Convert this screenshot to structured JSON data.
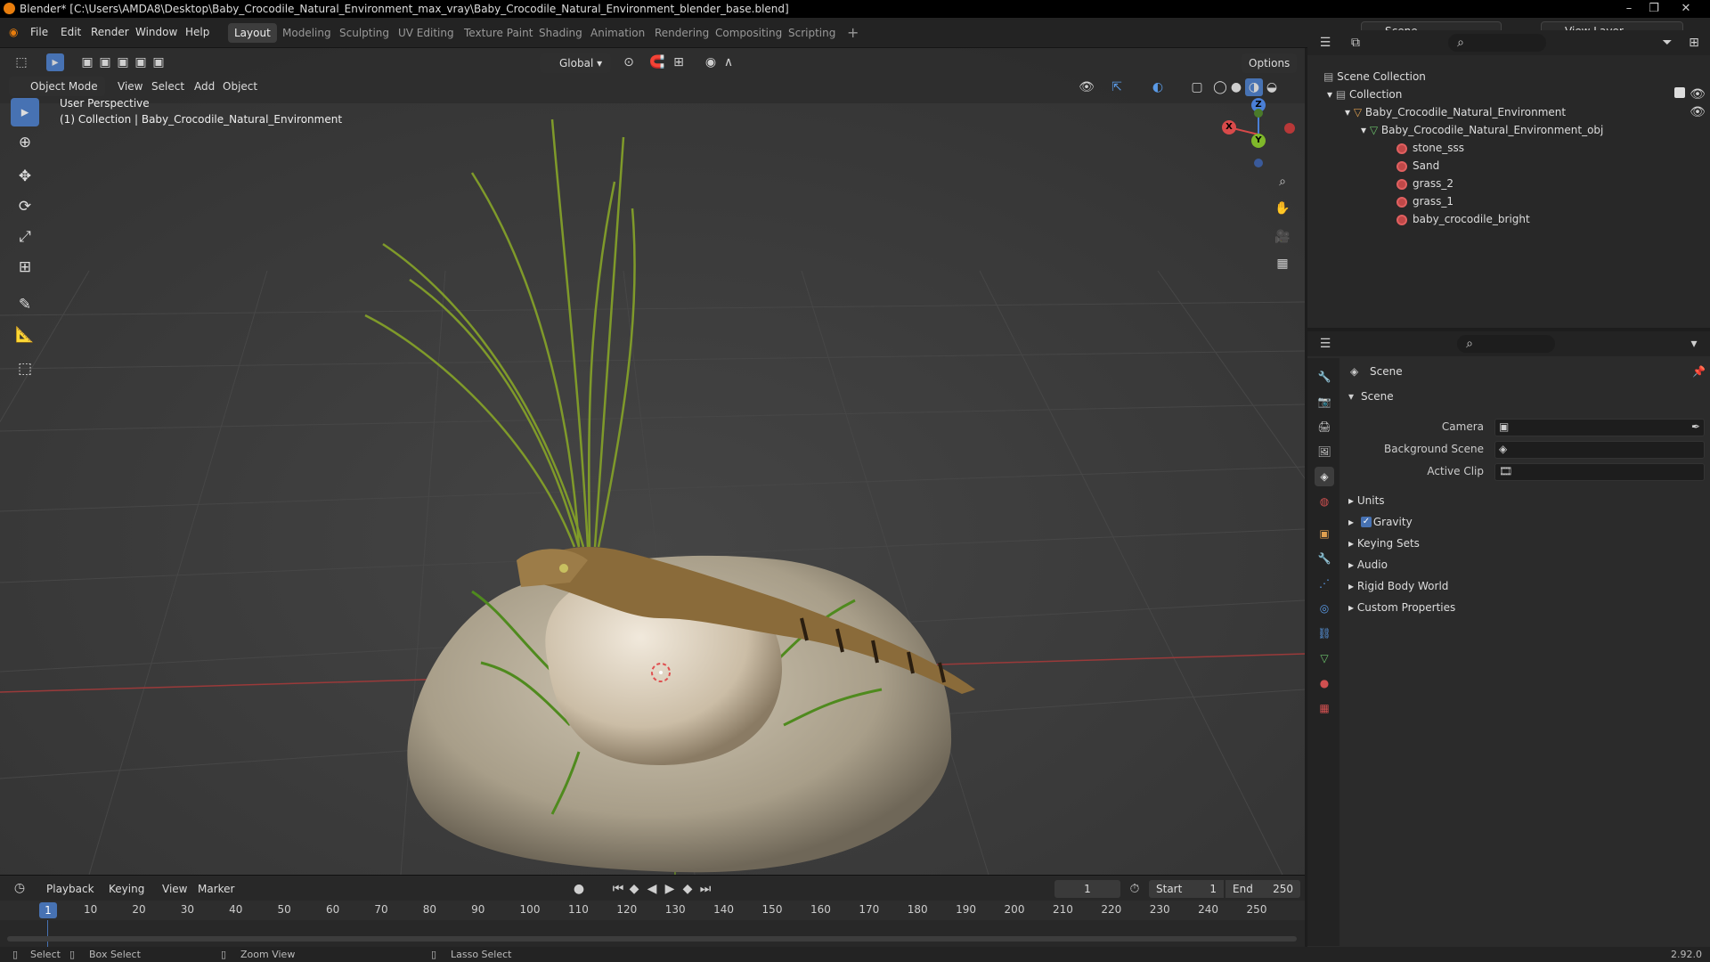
{
  "window": {
    "title": "Blender* [C:\\Users\\AMDA8\\Desktop\\Baby_Crocodile_Natural_Environment_max_vray\\Baby_Crocodile_Natural_Environment_blender_base.blend]"
  },
  "menu": [
    "File",
    "Edit",
    "Render",
    "Window",
    "Help"
  ],
  "workspaces": [
    "Layout",
    "Modeling",
    "Sculpting",
    "UV Editing",
    "Texture Paint",
    "Shading",
    "Animation",
    "Rendering",
    "Compositing",
    "Scripting"
  ],
  "active_workspace": "Layout",
  "scene_field": "Scene",
  "view_layer_field": "View Layer",
  "header": {
    "transform_orientation": "Global",
    "options": "Options",
    "mode": "Object Mode",
    "view_menu": [
      "View",
      "Select",
      "Add",
      "Object"
    ]
  },
  "viewport": {
    "perspective": "User Perspective",
    "collection_info": "(1) Collection | Baby_Crocodile_Natural_Environment",
    "gizmo": {
      "x": "X",
      "y": "Y",
      "z": "Z"
    }
  },
  "outliner": {
    "root": "Scene Collection",
    "collection": "Collection",
    "object": "Baby_Crocodile_Natural_Environment",
    "mesh": "Baby_Crocodile_Natural_Environment_obj",
    "materials": [
      "stone_sss",
      "Sand",
      "grass_2",
      "grass_1",
      "baby_crocodile_bright"
    ]
  },
  "properties": {
    "context": "Scene",
    "panel": "Scene",
    "camera_label": "Camera",
    "background_scene_label": "Background Scene",
    "active_clip_label": "Active Clip",
    "subpanels": [
      "Units",
      "Gravity",
      "Keying Sets",
      "Audio",
      "Rigid Body World",
      "Custom Properties"
    ],
    "gravity_checked": true
  },
  "timeline": {
    "menus": [
      "Playback",
      "Keying",
      "View",
      "Marker"
    ],
    "current_frame": "1",
    "start_label": "Start",
    "start": "1",
    "end_label": "End",
    "end": "250",
    "ticks": [
      "10",
      "20",
      "30",
      "40",
      "50",
      "60",
      "70",
      "80",
      "90",
      "100",
      "110",
      "120",
      "130",
      "140",
      "150",
      "160",
      "170",
      "180",
      "190",
      "200",
      "210",
      "220",
      "230",
      "240",
      "250"
    ],
    "playhead": "1"
  },
  "status": {
    "select": "Select",
    "box_select": "Box Select",
    "zoom_view": "Zoom View",
    "lasso_select": "Lasso Select",
    "version": "2.92.0"
  }
}
